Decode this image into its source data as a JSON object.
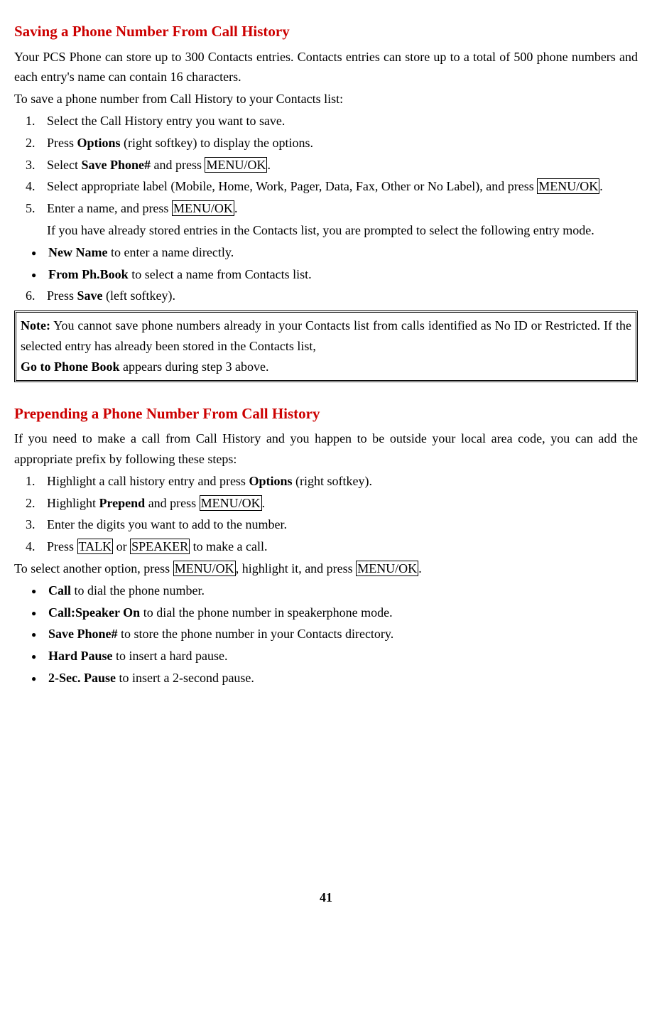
{
  "s1": {
    "heading": "Saving a Phone Number From Call History",
    "intro": "Your PCS Phone can store up to 300 Contacts entries. Contacts entries can store up to a total of 500 phone numbers and each entry's name can contain 16 characters.",
    "todo": "To save a phone number from Call History to your Contacts list:",
    "step1": "Select the Call History entry you want to save.",
    "step2a": "Press ",
    "step2b": "Options",
    "step2c": " (right softkey) to display the options.",
    "step3a": "Select ",
    "step3b": "Save Phone#",
    "step3c": " and press ",
    "step3d": "MENU/OK",
    "step3e": ".",
    "step4a": "Select appropriate label (Mobile, Home, Work, Pager, Data, Fax, Other or No Label), and press ",
    "step4b": "MENU/OK",
    "step4c": ".",
    "step5a": "Enter a name, and press ",
    "step5b": "MENU/OK",
    "step5c": ".",
    "step5sub": "If you have already stored entries in the Contacts list, you are prompted to select the following entry mode.",
    "bul1a": "New Name",
    "bul1b": " to enter a name directly.",
    "bul2a": "From Ph.Book",
    "bul2b": " to select a name from Contacts list.",
    "step6a": "Press ",
    "step6b": "Save",
    "step6c": " (left softkey).",
    "note1a": "Note:",
    "note1b": " You cannot save phone numbers already in your Contacts list from calls identified as No ID or Restricted. If the selected entry has already been stored in the Contacts list,",
    "note2a": "Go to Phone Book",
    "note2b": " appears during step 3 above."
  },
  "s2": {
    "heading": "Prepending a Phone Number From Call History",
    "intro": "If you need to make a call from Call History and you happen to be outside your local area code, you can add the appropriate prefix by following these steps:",
    "step1a": "Highlight a call history entry and press ",
    "step1b": "Options",
    "step1c": " (right softkey).",
    "step2a": "Highlight ",
    "step2b": "Prepend",
    "step2c": " and press ",
    "step2d": "MENU/OK",
    "step2e": ".",
    "step3": "Enter the digits you want to add to the number.",
    "step4a": "Press ",
    "step4b": "TALK",
    "step4c": " or ",
    "step4d": "SPEAKER",
    "step4e": " to make a call.",
    "after1": "To select another option, press ",
    "after2": "MENU/OK",
    "after3": ", highlight it, and press ",
    "after4": "MENU/OK",
    "after5": ".",
    "b1a": "Call",
    "b1b": " to dial the phone number.",
    "b2a": "Call:Speaker On",
    "b2b": " to dial the phone number in speakerphone mode.",
    "b3a": "Save Phone#",
    "b3b": " to store the phone number in your Contacts directory.",
    "b4a": "Hard Pause",
    "b4b": " to insert a hard pause.",
    "b5a": "2-Sec. Pause",
    "b5b": " to insert a 2-second pause."
  },
  "page": "41"
}
